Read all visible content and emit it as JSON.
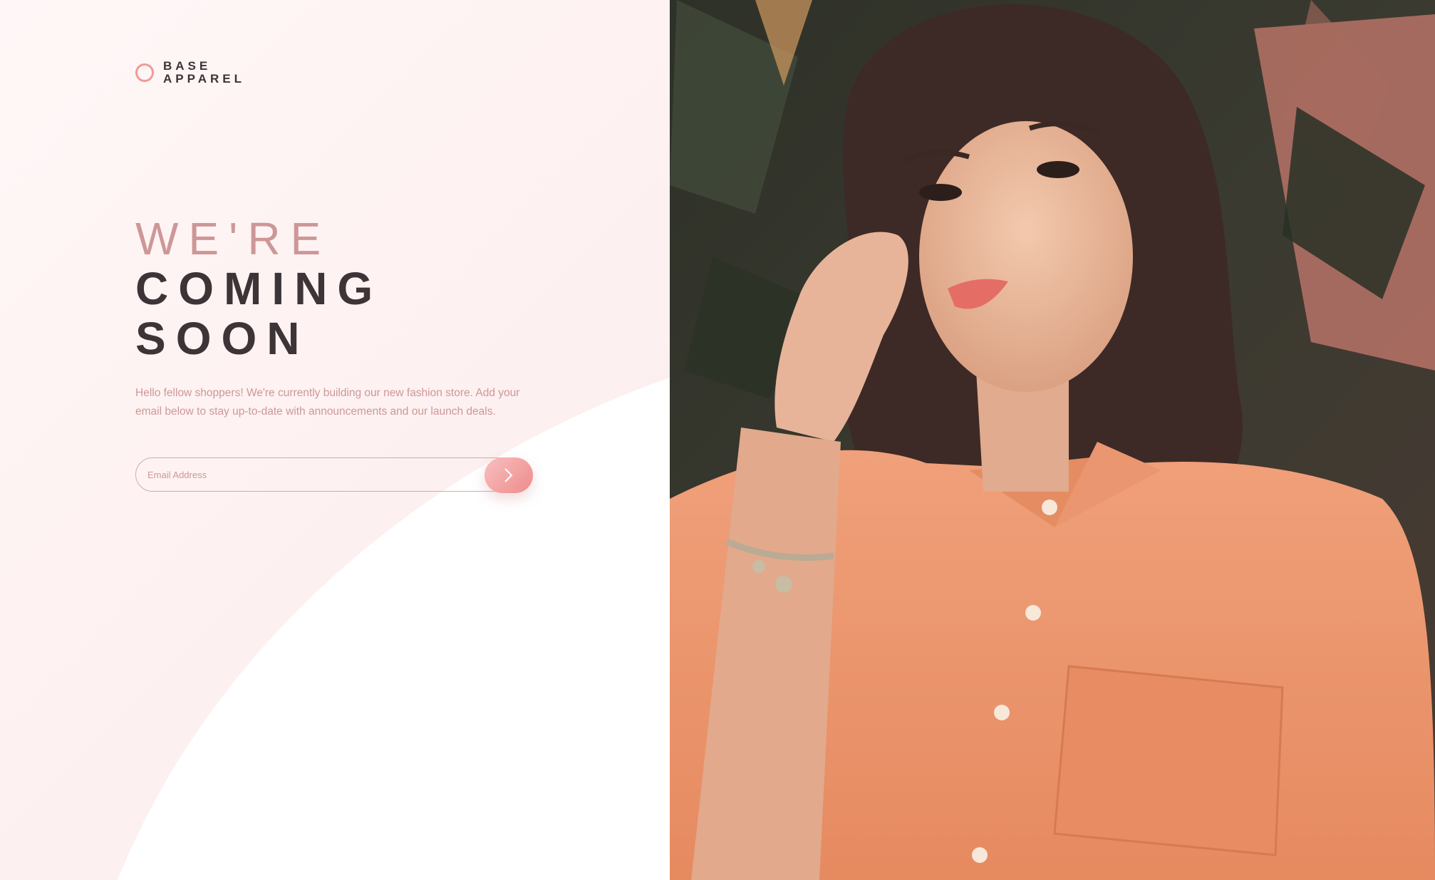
{
  "logo": {
    "line1": "BASE",
    "line2": "APPAREL"
  },
  "headline": {
    "line1": "WE'RE",
    "line2": "COMING",
    "line3": "SOON"
  },
  "description": "Hello fellow shoppers! We're currently building our new fashion store. Add your email below to stay up-to-date with announcements and our launch deals.",
  "form": {
    "email_placeholder": "Email Address"
  },
  "colors": {
    "accent_pink": "#ee8b8b",
    "text_pink": "#ce9797",
    "dark_text": "#3c3436",
    "background": "#fdf0f0"
  },
  "icons": {
    "logo": "circle-logo-icon",
    "submit": "chevron-right-icon"
  }
}
